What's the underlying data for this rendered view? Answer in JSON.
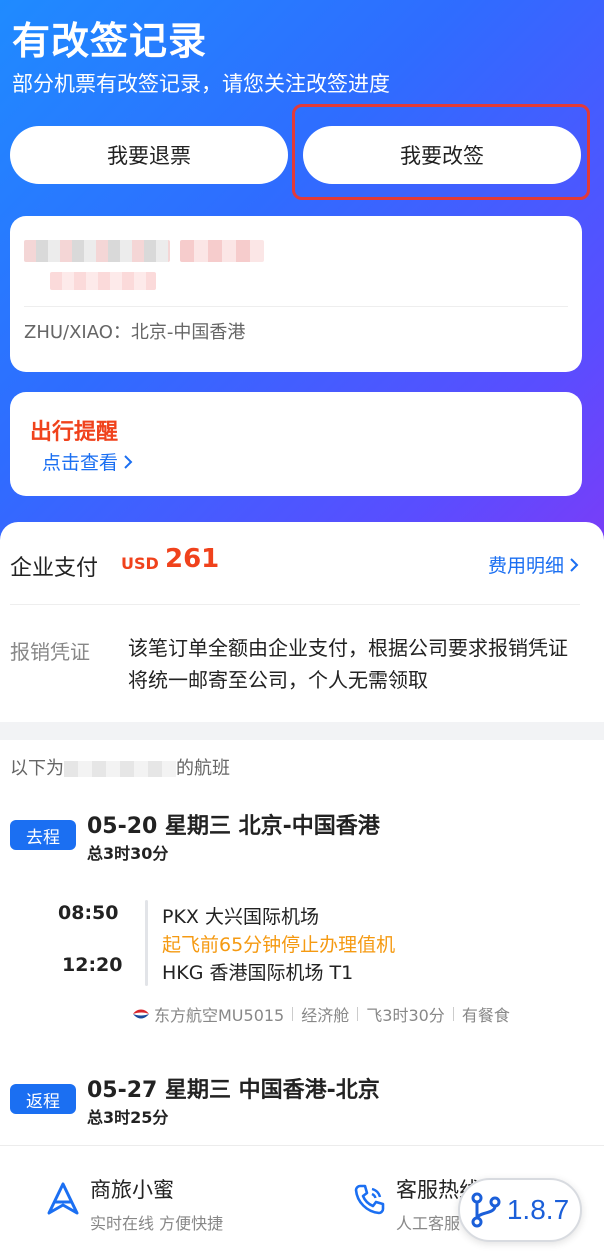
{
  "hero": {
    "title": "有改签记录",
    "subtitle": "部分机票有改签记录，请您关注改签进度"
  },
  "actions": {
    "refund_label": "我要退票",
    "change_label": "我要改签"
  },
  "passenger": {
    "route_text": "ZHU/XIAO：北京-中国香港"
  },
  "reminder": {
    "title": "出行提醒",
    "link_label": "点击查看"
  },
  "payment": {
    "label": "企业支付",
    "currency": "USD",
    "amount": "261",
    "fee_link": "费用明细",
    "voucher_label": "报销凭证",
    "voucher_text": "该笔订单全额由企业支付，根据公司要求报销凭证将统一邮寄至公司，个人无需领取"
  },
  "flights": {
    "note_prefix": "以下为",
    "note_suffix": "的航班",
    "outbound": {
      "badge": "去程",
      "date_route": "05-20 星期三 北京-中国香港",
      "duration": "总3时30分",
      "dep_time": "08:50",
      "arr_time": "12:20",
      "dep_airport": "PKX 大兴国际机场",
      "checkin_warning": "起飞前65分钟停止办理值机",
      "arr_airport": "HKG 香港国际机场 T1",
      "airline": "东方航空MU5015",
      "cabin": "经济舱",
      "flight_time": "飞3时30分",
      "meal": "有餐食"
    },
    "return": {
      "badge": "返程",
      "date_route": "05-27 星期三 中国香港-北京",
      "duration": "总3时25分"
    }
  },
  "bottom_bar": {
    "assistant_title": "商旅小蜜",
    "assistant_sub": "实时在线 方便快捷",
    "hotline_title": "客服热线",
    "hotline_sub": "人工客服"
  },
  "version": "1.8.7",
  "colors": {
    "accent": "#1b6ff2",
    "price": "#f0421c",
    "warning": "#f59a12",
    "highlight": "#e23a3a"
  }
}
